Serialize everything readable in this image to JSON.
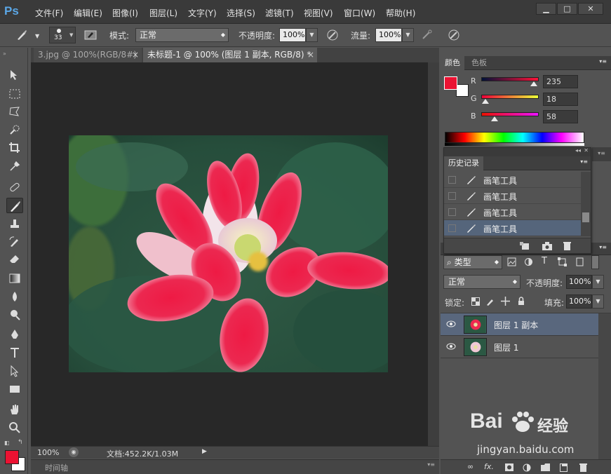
{
  "app": {
    "logo": "Ps"
  },
  "menu": [
    "文件(F)",
    "编辑(E)",
    "图像(I)",
    "图层(L)",
    "文字(Y)",
    "选择(S)",
    "滤镜(T)",
    "视图(V)",
    "窗口(W)",
    "帮助(H)"
  ],
  "window_controls": {
    "minimize": "▁",
    "maximize": "□",
    "close": "✕"
  },
  "options": {
    "brush_size": "33",
    "mode_label": "模式:",
    "mode_value": "正常",
    "opacity_label": "不透明度:",
    "opacity_value": "100%",
    "flow_label": "流量:",
    "flow_value": "100%"
  },
  "doc_tabs": [
    {
      "label": "3.jpg @ 100%(RGB/8#)",
      "close": "×"
    },
    {
      "label": "未标题-1 @ 100% (图层 1 副本, RGB/8) *",
      "close": "×"
    }
  ],
  "status": {
    "zoom": "100%",
    "doc_info": "文档:452.2K/1.03M"
  },
  "timeline": {
    "label": "时间轴"
  },
  "color_panel": {
    "tabs": [
      "颜色",
      "色板"
    ],
    "fg_color": "#EB1232",
    "channels": [
      {
        "name": "R",
        "value": "235",
        "fraction": 0.92
      },
      {
        "name": "G",
        "value": "18",
        "fraction": 0.07
      },
      {
        "name": "B",
        "value": "58",
        "fraction": 0.23
      }
    ]
  },
  "history_panel": {
    "title": "历史记录",
    "items": [
      "画笔工具",
      "画笔工具",
      "画笔工具",
      "画笔工具"
    ],
    "selected_index": 3
  },
  "layers_panel": {
    "filter_label": "类型",
    "blend_mode": "正常",
    "opacity_label": "不透明度:",
    "opacity_value": "100%",
    "lock_label": "锁定:",
    "fill_label": "填充:",
    "fill_value": "100%",
    "layers": [
      {
        "name": "图层 1 副本",
        "selected": true
      },
      {
        "name": "图层 1",
        "selected": false
      }
    ],
    "footer_fx": "fx."
  },
  "watermark": {
    "brand": "Bai",
    "brand_suffix": "经验",
    "url": "jingyan.baidu.com"
  }
}
